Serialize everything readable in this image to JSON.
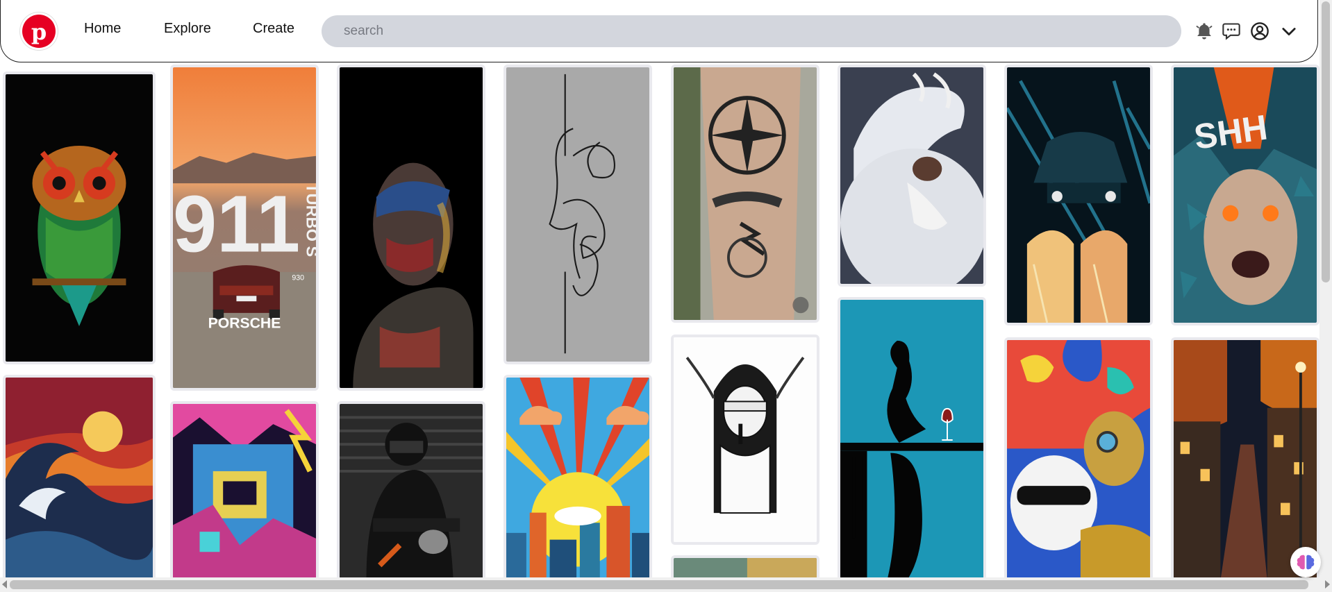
{
  "brand": {
    "logo_letter": "p",
    "color": "#e60023"
  },
  "nav": {
    "home": "Home",
    "explore": "Explore",
    "create": "Create"
  },
  "search": {
    "placeholder": "search",
    "value": ""
  },
  "header_icons": [
    "bell-icon",
    "chat-icon",
    "profile-icon",
    "chevron-down-icon"
  ],
  "pins": [
    {
      "subject": "owl"
    },
    {
      "subject": "porsche-911",
      "text_main": "911",
      "text_side": "TURBO S",
      "text_small": "930",
      "text_bottom": "PORSCHE"
    },
    {
      "subject": "painted-face"
    },
    {
      "subject": "line-face"
    },
    {
      "subject": "tattoo-arm"
    },
    {
      "subject": "dragon"
    },
    {
      "subject": "teal-car"
    },
    {
      "subject": "shattered-face",
      "text_main": "SHH"
    },
    {
      "subject": "wave-sunset"
    },
    {
      "subject": "robot-city"
    },
    {
      "subject": "motorcyclist"
    },
    {
      "subject": "pop-city"
    },
    {
      "subject": "nun"
    },
    {
      "subject": "wine-silhouette"
    },
    {
      "subject": "skulls"
    },
    {
      "subject": "night-street"
    },
    {
      "subject": "bottom-strip"
    }
  ]
}
